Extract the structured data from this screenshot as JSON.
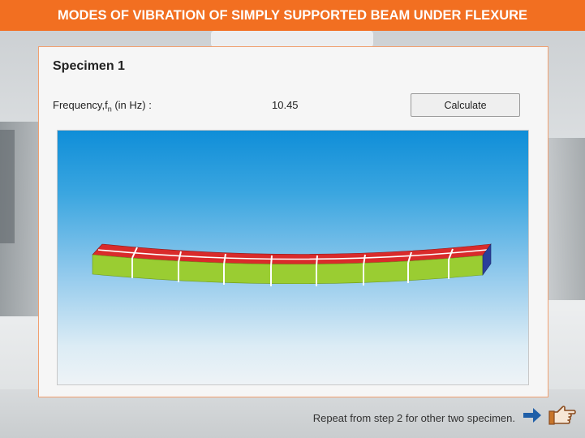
{
  "header": {
    "title": "MODES OF VIBRATION OF SIMPLY SUPPORTED BEAM UNDER FLEXURE"
  },
  "panel": {
    "specimen_title": "Specimen 1",
    "frequency_label": "Frequency,f",
    "frequency_subscript": "n",
    "frequency_unit": " (in Hz) :",
    "frequency_value": "10.45",
    "calculate_label": "Calculate"
  },
  "footer": {
    "instruction": "Repeat from step 2 for other two specimen.",
    "next_icon": "arrow-right-icon",
    "pointer_icon": "hand-pointer-icon"
  },
  "colors": {
    "header": "#f26f21",
    "beam_side": "#9acd32",
    "beam_top": "#d92b2b",
    "beam_end": "#2a3f9a"
  }
}
